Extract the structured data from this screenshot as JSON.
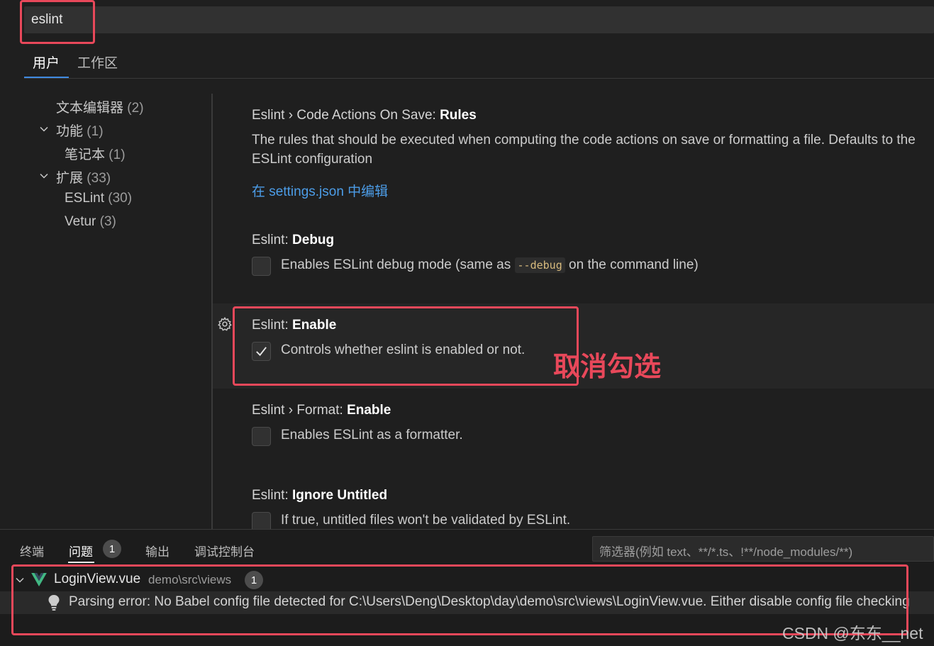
{
  "search": {
    "value": "eslint"
  },
  "scope_tabs": [
    {
      "label": "用户",
      "active": true
    },
    {
      "label": "工作区",
      "active": false
    }
  ],
  "tree": [
    {
      "label": "文本编辑器",
      "count": "(2)",
      "expanded": null
    },
    {
      "label": "功能",
      "count": "(1)",
      "expanded": true
    },
    {
      "label": "笔记本",
      "count": "(1)",
      "expanded": null
    },
    {
      "label": "扩展",
      "count": "(33)",
      "expanded": true
    },
    {
      "label": "ESLint",
      "count": "(30)",
      "expanded": null
    },
    {
      "label": "Vetur",
      "count": "(3)",
      "expanded": null
    }
  ],
  "settings": [
    {
      "category": "Eslint › Code Actions On Save: ",
      "name": "Rules",
      "desc_line1": "The rules that should be executed when computing the code actions on save or formatting a file. Defaults to the",
      "desc_line2": "ESLint configuration",
      "link": "在 settings.json 中编辑"
    },
    {
      "category": "Eslint: ",
      "name": "Debug",
      "desc_pre": "Enables ESLint debug mode (same as ",
      "desc_code": "--debug",
      "desc_post": " on the command line)",
      "checked": false
    },
    {
      "category": "Eslint: ",
      "name": "Enable",
      "desc": "Controls whether eslint is enabled or not.",
      "checked": true
    },
    {
      "category": "Eslint › Format: ",
      "name": "Enable",
      "desc": "Enables ESLint as a formatter.",
      "checked": false
    },
    {
      "category": "Eslint: ",
      "name": "Ignore Untitled",
      "desc": "If true, untitled files won't be validated by ESLint.",
      "checked": false
    }
  ],
  "annotation": "取消勾选",
  "panel": {
    "tabs": [
      {
        "label": "终端",
        "active": false
      },
      {
        "label": "问题",
        "active": true,
        "badge": "1"
      },
      {
        "label": "输出",
        "active": false
      },
      {
        "label": "调试控制台",
        "active": false
      }
    ],
    "filter_placeholder": "筛选器(例如 text、**/*.ts、!**/node_modules/**)",
    "problem_file": {
      "name": "LoginView.vue",
      "path": "demo\\src\\views",
      "count": "1",
      "message": "Parsing error: No Babel config file detected for C:\\Users\\Deng\\Desktop\\day\\demo\\src\\views\\LoginView.vue. Either disable config file checking"
    }
  },
  "watermark": "CSDN @东东__net",
  "colors": {
    "accent": "#3f8ae0",
    "annotation_red": "#e8485a",
    "vue_green": "#41b883",
    "link": "#4c9de8"
  }
}
